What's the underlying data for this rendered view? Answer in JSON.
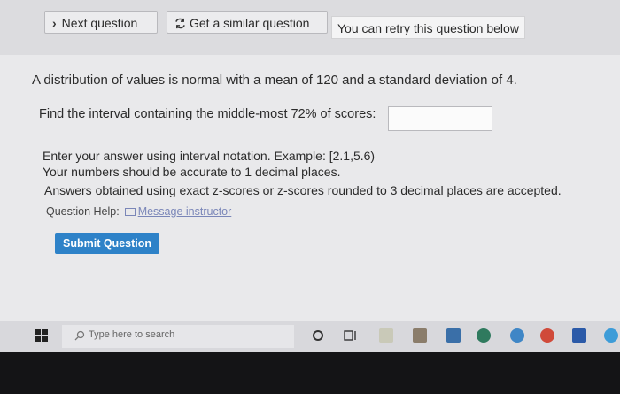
{
  "topbar": {
    "next_label": "Next question",
    "similar_label": "Get a similar question",
    "retry_text": "You can retry this question below"
  },
  "question": {
    "problem": "A distribution of values is normal with a mean of 120 and a standard deviation of 4.",
    "prompt": "Find the interval containing the middle-most 72% of scores:",
    "answer_value": "",
    "instruction_1": "Enter your answer using interval notation. Example: [2.1,5.6)",
    "instruction_2": "Your numbers should be accurate to 1 decimal places.",
    "instruction_3": "Answers obtained using exact z-scores or z-scores rounded to 3 decimal places are accepted."
  },
  "help": {
    "label": "Question Help:",
    "link": "Message instructor"
  },
  "submit_label": "Submit Question",
  "taskbar": {
    "search_placeholder": "Type here to search"
  }
}
